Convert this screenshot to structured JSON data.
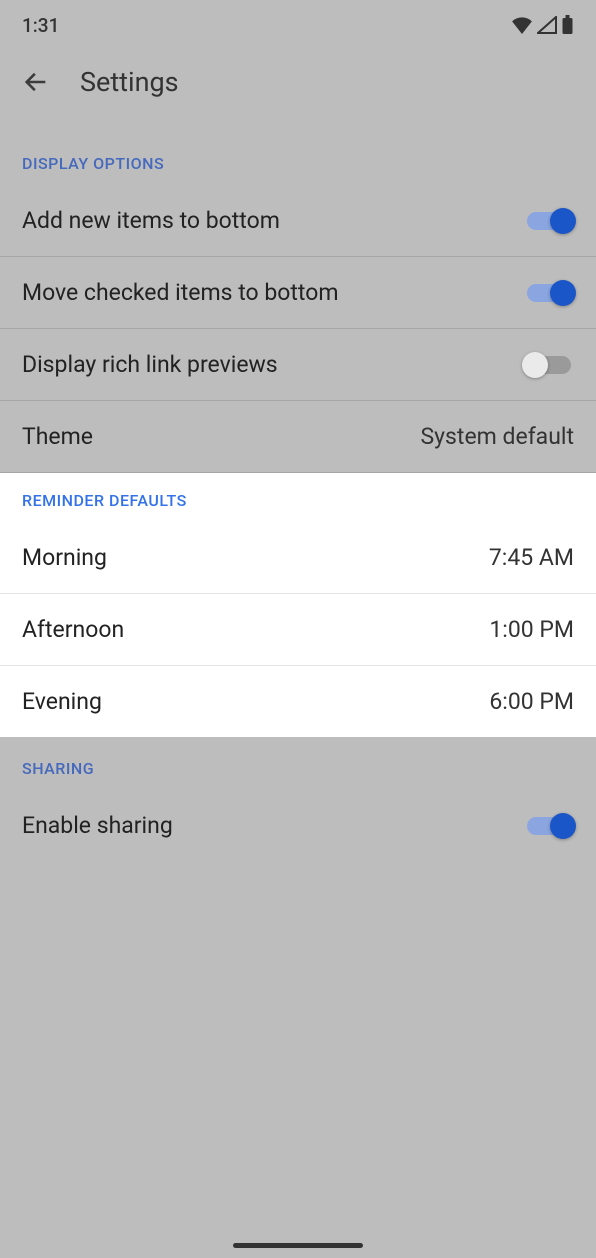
{
  "status": {
    "time": "1:31"
  },
  "header": {
    "title": "Settings"
  },
  "sections": {
    "display": {
      "title": "DISPLAY OPTIONS",
      "items": {
        "addBottom": {
          "label": "Add new items to bottom",
          "on": true
        },
        "moveChecked": {
          "label": "Move checked items to bottom",
          "on": true
        },
        "richLinks": {
          "label": "Display rich link previews",
          "on": false
        },
        "theme": {
          "label": "Theme",
          "value": "System default"
        }
      }
    },
    "reminders": {
      "title": "REMINDER DEFAULTS",
      "items": {
        "morning": {
          "label": "Morning",
          "value": "7:45 AM"
        },
        "afternoon": {
          "label": "Afternoon",
          "value": "1:00 PM"
        },
        "evening": {
          "label": "Evening",
          "value": "6:00 PM"
        }
      }
    },
    "sharing": {
      "title": "SHARING",
      "items": {
        "enable": {
          "label": "Enable sharing",
          "on": true
        }
      }
    }
  }
}
